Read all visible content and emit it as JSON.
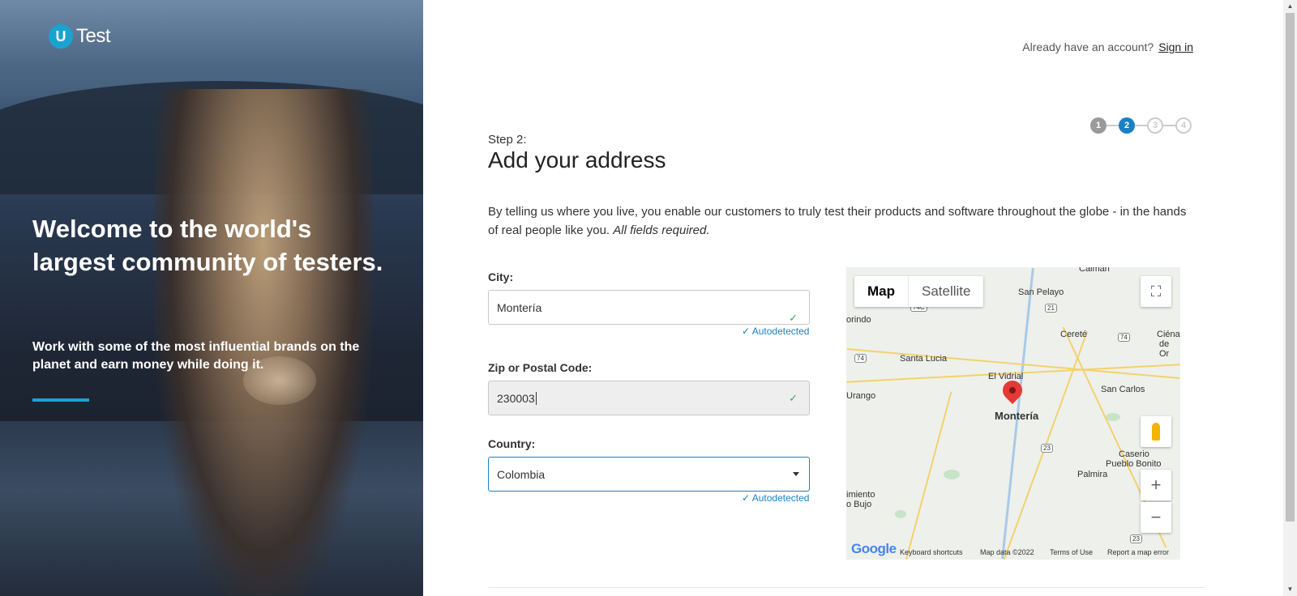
{
  "brand": {
    "logo_mark": "U",
    "logo_text": "Test"
  },
  "hero": {
    "title": "Welcome to the world's largest community of testers.",
    "subtitle": "Work with some of the most influential brands on the planet and earn money while doing it.",
    "accent_color": "#1aa3d1"
  },
  "header": {
    "account_prompt": "Already have an account?",
    "signin_label": "Sign in"
  },
  "steps": [
    {
      "label": "1",
      "state": "done"
    },
    {
      "label": "2",
      "state": "active"
    },
    {
      "label": "3",
      "state": "todo"
    },
    {
      "label": "4",
      "state": "todo"
    }
  ],
  "form": {
    "step_label": "Step 2:",
    "title": "Add your address",
    "intro": "By telling us where you live, you enable our customers to truly test their products and software throughout the globe - in the hands of real people like you.",
    "intro_emphasis": "All fields required.",
    "city": {
      "label": "City:",
      "value": "Montería",
      "note": "Autodetected",
      "icon": "check-icon"
    },
    "zip": {
      "label": "Zip or Postal Code:",
      "value": "230003",
      "icon": "check-icon"
    },
    "country": {
      "label": "Country:",
      "value": "Colombia",
      "note": "Autodetected",
      "icon": "chevron-down-icon"
    }
  },
  "map": {
    "type_map": "Map",
    "type_satellite": "Satellite",
    "towns": [
      "San Pelayo",
      "orindo",
      "Cereté",
      "Ciénag",
      "de Or",
      "Santa Lucia",
      "El Vidrial",
      "Urango",
      "Montería",
      "San Carlos",
      "Caserio",
      "Pueblo Bonito",
      "Palmira",
      "imiento",
      "o Bujo",
      "Calman"
    ],
    "shields": [
      "74C",
      "21",
      "74",
      "74",
      "23",
      "23"
    ],
    "google": "Google",
    "footer": {
      "shortcuts": "Keyboard shortcuts",
      "data": "Map data ©2022",
      "terms": "Terms of Use",
      "report": "Report a map error"
    }
  },
  "colors": {
    "primary": "#1a80c4",
    "success": "#3aa757",
    "step_done": "#9a9a9a"
  }
}
